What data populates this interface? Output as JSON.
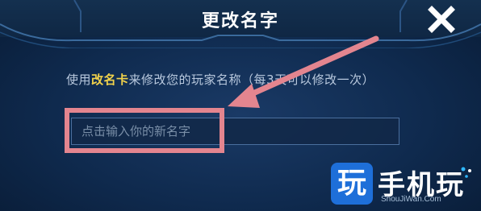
{
  "dialog": {
    "title": "更改名字",
    "close_icon": "close-icon"
  },
  "hint": {
    "prefix": "使用",
    "item": "改名卡",
    "suffix": "来修改您的玩家名称（每3天可以修改一次）"
  },
  "name_input": {
    "placeholder": "点击输入你的新名字",
    "value": ""
  },
  "annotation": {
    "box_color": "#e3858f",
    "arrow_color": "#e3858f"
  },
  "watermark": {
    "tile": "玩",
    "text": "手机玩",
    "sub": "ShouJiWan.Com"
  },
  "colors": {
    "background": "#0f2a4e",
    "highlight_text": "#f1d24b",
    "hint_text": "#b9c9de"
  }
}
